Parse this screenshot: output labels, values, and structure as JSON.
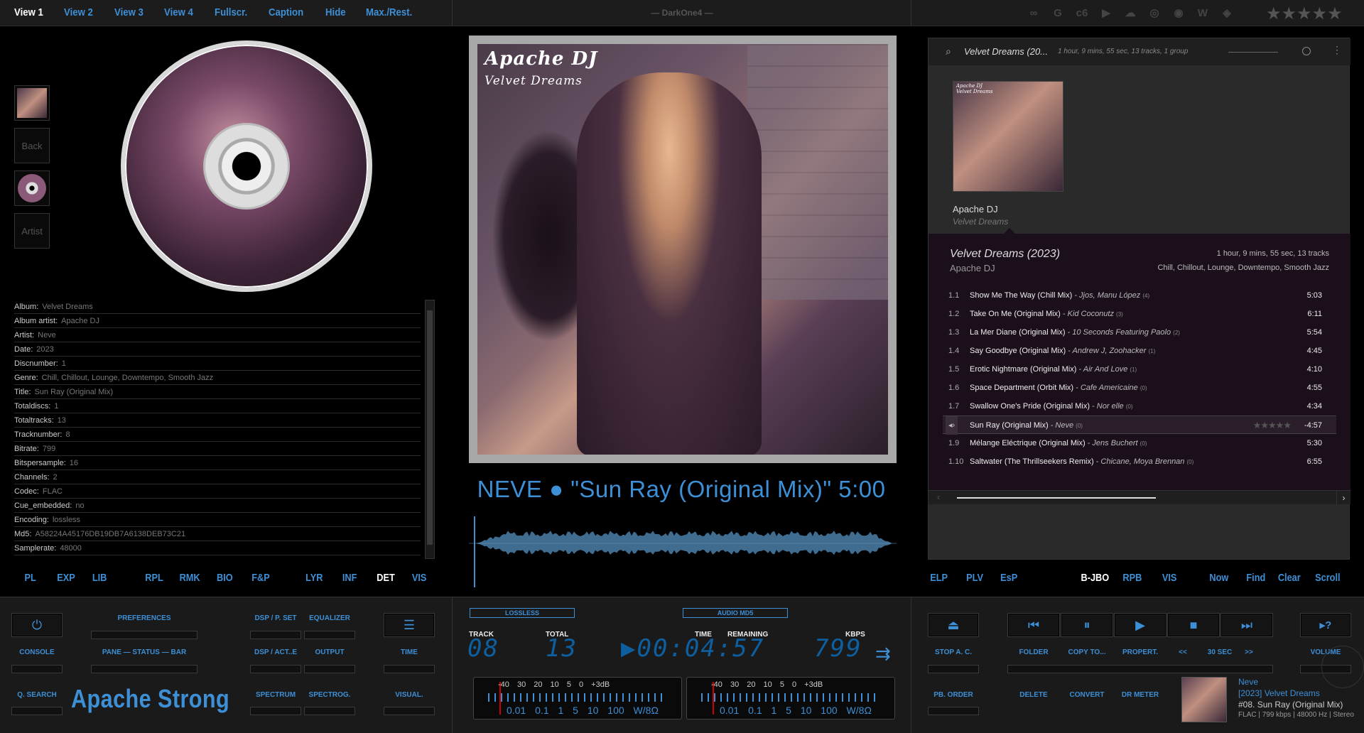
{
  "topbar": {
    "nav": [
      "View 1",
      "View 2",
      "View 3",
      "View 4",
      "Fullscr.",
      "Caption",
      "Hide",
      "Max./Rest."
    ],
    "title": "— DarkOne4 —",
    "services": [
      "∞",
      "G",
      "c6",
      "▶",
      "☁",
      "◎",
      "◉",
      "W",
      "◈"
    ]
  },
  "left": {
    "side_buttons": [
      "Back",
      "Artist"
    ],
    "metadata": [
      {
        "k": "Album:",
        "v": "Velvet Dreams"
      },
      {
        "k": "Album artist:",
        "v": "Apache DJ"
      },
      {
        "k": "Artist:",
        "v": "Neve"
      },
      {
        "k": "Date:",
        "v": "2023"
      },
      {
        "k": "Discnumber:",
        "v": "1"
      },
      {
        "k": "Genre:",
        "v": "Chill, Chillout, Lounge, Downtempo, Smooth Jazz"
      },
      {
        "k": "Title:",
        "v": "Sun Ray (Original Mix)"
      },
      {
        "k": "Totaldiscs:",
        "v": "1"
      },
      {
        "k": "Totaltracks:",
        "v": "13"
      },
      {
        "k": "Tracknumber:",
        "v": "8"
      },
      {
        "k": "Bitrate:",
        "v": "799"
      },
      {
        "k": "Bitspersample:",
        "v": "16"
      },
      {
        "k": "Channels:",
        "v": "2"
      },
      {
        "k": "Codec:",
        "v": "FLAC"
      },
      {
        "k": "Cue_embedded:",
        "v": "no"
      },
      {
        "k": "Encoding:",
        "v": "lossless"
      },
      {
        "k": "Md5:",
        "v": "A58224A45176DB19DB7A6138DEB73C21"
      },
      {
        "k": "Samplerate:",
        "v": "48000"
      }
    ],
    "tabs": [
      "PL",
      "EXP",
      "LIB",
      "RPL",
      "RMK",
      "BIO",
      "F&P",
      "LYR",
      "INF",
      "DET",
      "VIS"
    ]
  },
  "center": {
    "cover_artist": "Apache DJ",
    "cover_album": "Velvet Dreams",
    "now_playing": "NEVE ● \"Sun Ray (Original Mix)\" 5:00"
  },
  "right": {
    "header_title": "Velvet Dreams (20...",
    "header_info": "1 hour, 9 mins, 55 sec,  13 tracks,  1 group",
    "art_artist": "Apache DJ",
    "art_album": "Velvet Dreams",
    "album_title": "Velvet Dreams (2023)",
    "album_time": "1 hour, 9 mins, 55 sec,  13 tracks",
    "album_artist": "Apache DJ",
    "album_genre": "Chill, Chillout, Lounge, Downtempo, Smooth Jazz",
    "tracks": [
      {
        "num": "1.1",
        "title": "Show Me The Way (Chill Mix)",
        "artist": "Jjos, Manu López",
        "count": "(4)",
        "dur": "5:03"
      },
      {
        "num": "1.2",
        "title": "Take On Me (Original Mix)",
        "artist": "Kid Coconutz",
        "count": "(3)",
        "dur": "6:11"
      },
      {
        "num": "1.3",
        "title": "La Mer Diane (Original Mix)",
        "artist": "10 Seconds Featuring Paolo",
        "count": "(2)",
        "dur": "5:54"
      },
      {
        "num": "1.4",
        "title": "Say Goodbye (Original Mix)",
        "artist": "Andrew J, Zoohacker",
        "count": "(1)",
        "dur": "4:45"
      },
      {
        "num": "1.5",
        "title": "Erotic Nightmare (Original Mix)",
        "artist": "Air And Love",
        "count": "(1)",
        "dur": "4:10"
      },
      {
        "num": "1.6",
        "title": "Space Department (Orbit Mix)",
        "artist": "Cafe Americaine",
        "count": "(0)",
        "dur": "4:55"
      },
      {
        "num": "1.7",
        "title": "Swallow One's Pride (Original Mix)",
        "artist": "Nor elle",
        "count": "(0)",
        "dur": "4:34"
      },
      {
        "num": "◂›",
        "title": "Sun Ray (Original Mix)",
        "artist": "Neve",
        "count": "(0)",
        "dur": "-4:57",
        "playing": true
      },
      {
        "num": "1.9",
        "title": "Mélange Eléctrique (Original Mix)",
        "artist": "Jens Buchert",
        "count": "(0)",
        "dur": "5:30"
      },
      {
        "num": "1.10",
        "title": "Saltwater (The Thrillseekers Remix)",
        "artist": "Chicane, Moya Brennan",
        "count": "(0)",
        "dur": "6:55"
      }
    ],
    "tabs": [
      "ELP",
      "PLV",
      "EsP",
      "B-JBO",
      "RPB",
      "VIS",
      "Now",
      "Find",
      "Clear",
      "Scroll"
    ]
  },
  "bottom": {
    "left_labels": {
      "console": "CONSOLE",
      "preferences": "PREFERENCES",
      "pane": "PANE — STATUS — BAR",
      "dsp_pset": "DSP / P. SET",
      "equalizer": "EQUALIZER",
      "dsp_act": "DSP / ACT..E",
      "output": "OUTPUT",
      "time": "TIME",
      "qsearch": "Q. SEARCH",
      "spectrum": "SPECTRUM",
      "spectrog": "SPECTROG.",
      "visual": "VISUAL."
    },
    "brand": "Apache Strong",
    "lcd": {
      "tag1": "LOSSLESS",
      "tag2": "AUDIO MD5",
      "track_label": "TRACK",
      "total_label": "TOTAL",
      "time_label": "TIME",
      "remaining_label": "REMAINING",
      "kbps_label": "KBPS",
      "track": "08",
      "total": "13",
      "time": "▶00:04:57",
      "kbps": "799",
      "scale_top": "-40 30 20 10 5 0 +3dB",
      "scale_bottom": "0.01 0.1 1 5 10 100 W/8Ω"
    },
    "right_labels": {
      "stop_ac": "STOP A. C.",
      "folder": "FOLDER",
      "copy": "COPY TO...",
      "propert": "PROPERT.",
      "back": "<<",
      "sec30": "30 SEC",
      "fwd": ">>",
      "volume": "VOLUME",
      "pb_order": "PB. ORDER",
      "delete": "DELETE",
      "convert": "CONVERT",
      "dr": "DR METER"
    },
    "mini": {
      "artist": "Neve",
      "album": "[2023] Velvet Dreams",
      "title": "#08. Sun Ray (Original Mix)",
      "info": "FLAC | 799 kbps | 48000 Hz | Stereo"
    }
  },
  "colors": {
    "accent": "#3d8fd6",
    "bg": "#000000",
    "panel": "#1a1a1a"
  }
}
